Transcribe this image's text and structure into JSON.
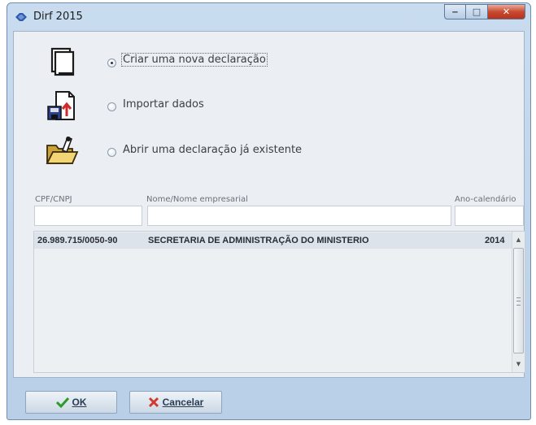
{
  "window": {
    "title": "Dirf 2015",
    "controls": {
      "minimize": "‒",
      "maximize": "□",
      "close": "✕"
    }
  },
  "options": [
    {
      "label": "Criar uma nova declaração",
      "selected": true,
      "icon": "new-document-icon"
    },
    {
      "label": "Importar dados",
      "selected": false,
      "icon": "import-data-icon"
    },
    {
      "label": "Abrir uma declaração já existente",
      "selected": false,
      "icon": "open-folder-icon"
    }
  ],
  "table": {
    "columns": [
      "CPF/CNPJ",
      "Nome/Nome empresarial",
      "Ano-calendário"
    ],
    "filters": [
      "",
      "",
      ""
    ],
    "rows": [
      {
        "cpf_cnpj": "26.989.715/0050-90",
        "nome": "SECRETARIA DE ADMINISTRAÇÃO DO MINISTERIO",
        "ano": "2014"
      }
    ]
  },
  "buttons": {
    "ok": "OK",
    "cancel": "Cancelar"
  },
  "colors": {
    "window_frame": "#b9cfe8",
    "client_bg": "#ebeef2",
    "selected_row": "#dde3ea",
    "close_button": "#c84a30"
  }
}
